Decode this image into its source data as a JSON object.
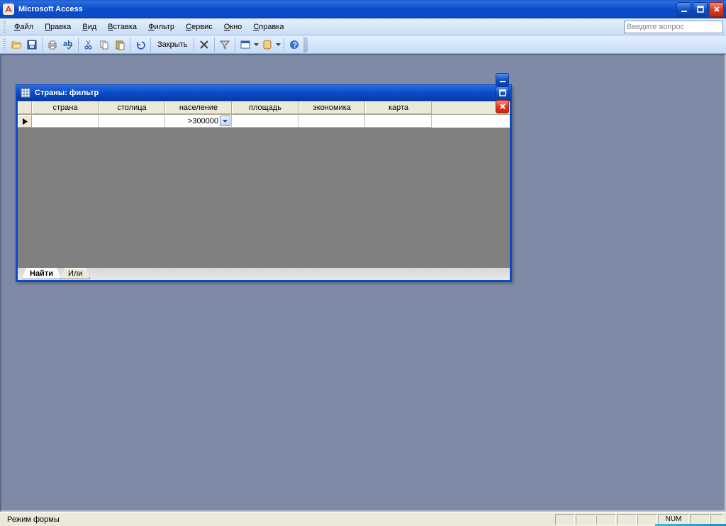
{
  "app": {
    "title": "Microsoft Access"
  },
  "menu": {
    "file": "Файл",
    "edit": "Правка",
    "view": "Вид",
    "insert": "Вставка",
    "filter": "Фильтр",
    "tools": "Сервис",
    "window": "Окно",
    "help": "Справка"
  },
  "help_search": {
    "placeholder": "Введите вопрос"
  },
  "toolbar": {
    "close_label": "Закрыть"
  },
  "child": {
    "title": "Страны: фильтр",
    "columns": [
      "страна",
      "столица",
      "население",
      "площадь",
      "экономика",
      "карта"
    ],
    "row": {
      "pop_filter": ">300000"
    },
    "tabs": {
      "find": "Найти",
      "or": "Или"
    }
  },
  "status": {
    "mode": "Режим формы",
    "num": "NUM"
  }
}
